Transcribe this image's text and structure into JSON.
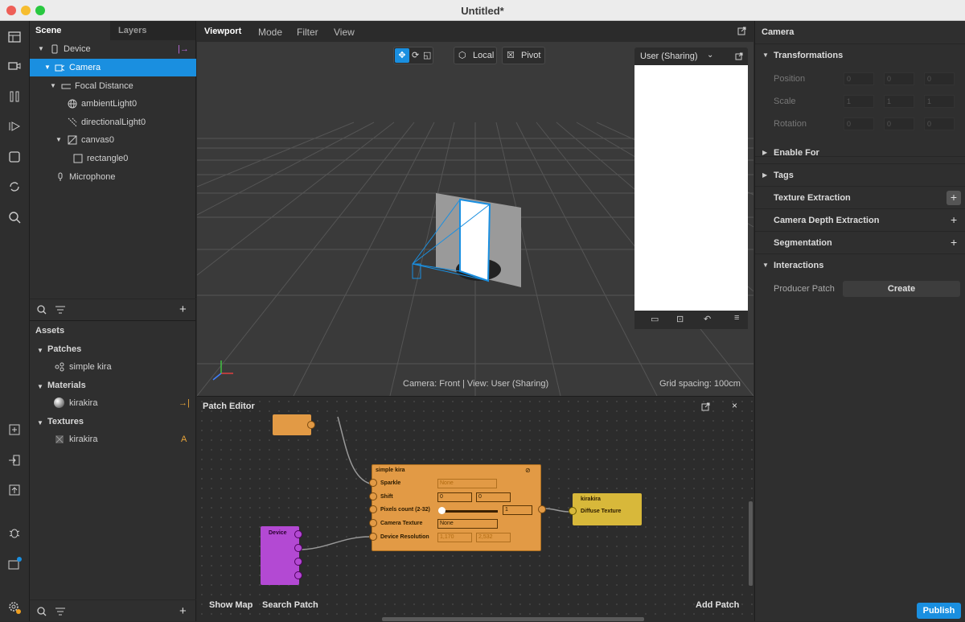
{
  "window": {
    "title": "Untitled*"
  },
  "scene_panel": {
    "tabs": [
      "Scene",
      "Layers"
    ],
    "tree": [
      {
        "label": "Device"
      },
      {
        "label": "Camera"
      },
      {
        "label": "Focal Distance"
      },
      {
        "label": "ambientLight0"
      },
      {
        "label": "directionalLight0"
      },
      {
        "label": "canvas0"
      },
      {
        "label": "rectangle0"
      },
      {
        "label": "Microphone"
      }
    ],
    "add": "+"
  },
  "assets_panel": {
    "title": "Assets",
    "sections": [
      {
        "label": "Patches",
        "items": [
          {
            "label": "simple kira",
            "badge": ""
          }
        ]
      },
      {
        "label": "Materials",
        "items": [
          {
            "label": "kirakira",
            "badge": "→|"
          }
        ]
      },
      {
        "label": "Textures",
        "items": [
          {
            "label": "kirakira",
            "badge": "A"
          }
        ]
      }
    ],
    "add": "+"
  },
  "viewport": {
    "tabs": [
      "Viewport",
      "Mode",
      "Filter",
      "View"
    ],
    "tools": {
      "local": "Local",
      "pivot": "Pivot"
    },
    "preview_label": "User (Sharing)",
    "status_left": "Camera: Front | View: User (Sharing)",
    "status_right": "Grid spacing: 100cm"
  },
  "patch_editor": {
    "title": "Patch Editor",
    "node_simple_kira": {
      "title": "simple kira",
      "rows": [
        {
          "label": "Sparkle",
          "value": "None"
        },
        {
          "label": "Shift",
          "v1": "0",
          "v2": "0"
        },
        {
          "label": "Pixels count (2-32)",
          "value": "1"
        },
        {
          "label": "Camera Texture",
          "value": "None"
        },
        {
          "label": "Device Resolution",
          "v1": "1,170",
          "v2": "2,532"
        }
      ]
    },
    "node_kirakira": {
      "title": "kirakira",
      "port": "Diffuse Texture"
    },
    "node_device": {
      "title": "Device"
    },
    "bottom": {
      "show_map": "Show Map",
      "search_patch": "Search Patch",
      "add_patch": "Add Patch"
    }
  },
  "properties": {
    "title": "Camera",
    "sections": {
      "transformations": "Transformations",
      "enable_for": "Enable For",
      "tags": "Tags",
      "texture_extraction": "Texture Extraction",
      "camera_depth": "Camera Depth Extraction",
      "segmentation": "Segmentation",
      "interactions": "Interactions"
    },
    "fields": {
      "position": "Position",
      "scale": "Scale",
      "rotation": "Rotation"
    },
    "values": {
      "position": [
        "0",
        "0",
        "0"
      ],
      "scale": [
        "1",
        "1",
        "1"
      ],
      "rotation": [
        "0",
        "0",
        "0"
      ]
    },
    "producer_patch": "Producer Patch",
    "create": "Create",
    "plus": "+",
    "publish": "Publish"
  },
  "colors": {
    "accent": "#1a8fe0",
    "patch_orange": "#e29a45",
    "patch_yellow": "#d8b83a",
    "patch_purple": "#b349d3"
  }
}
